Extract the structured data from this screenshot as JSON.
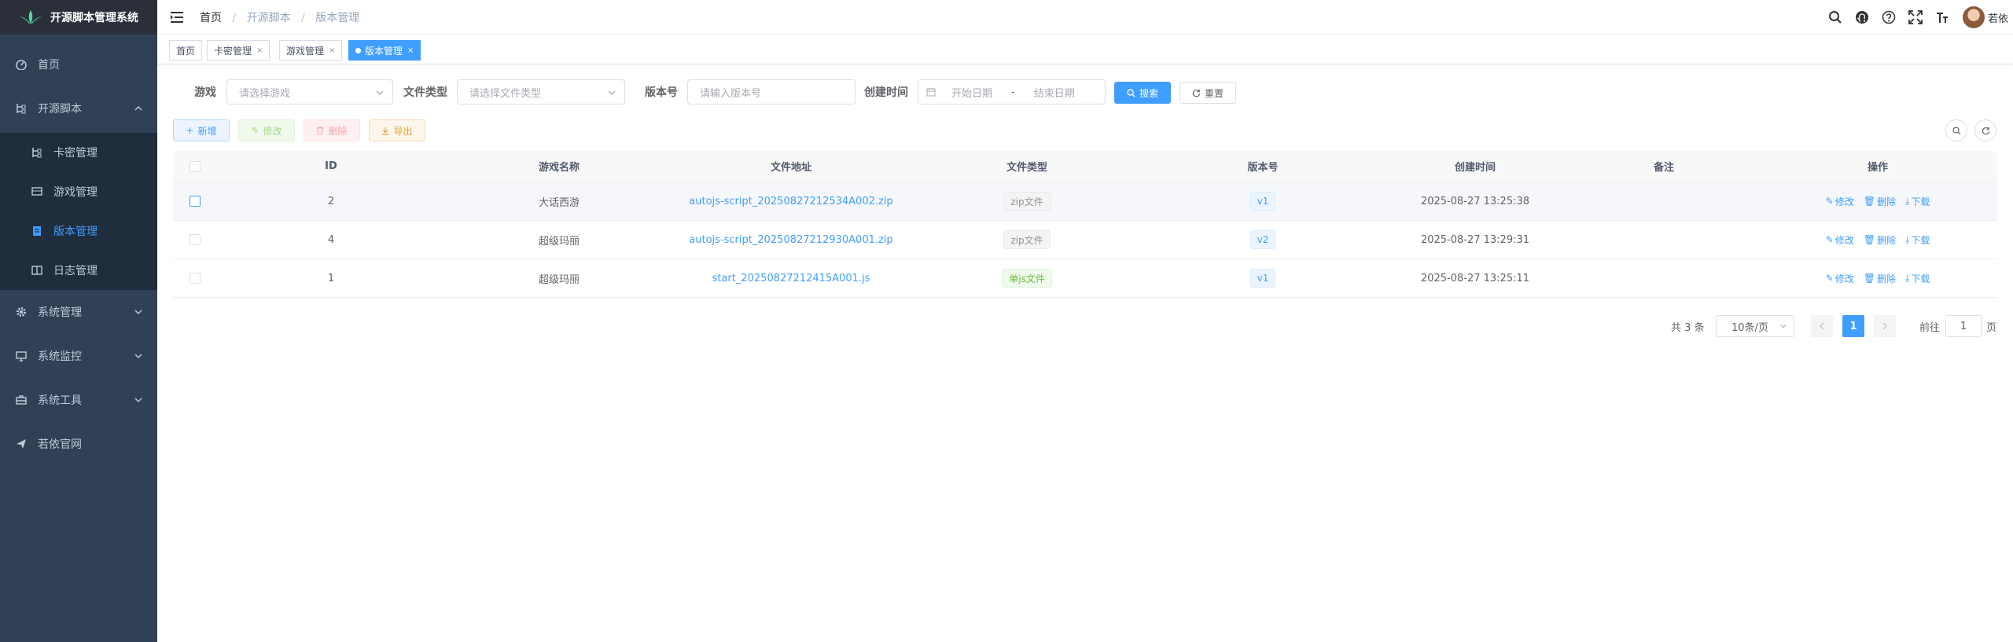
{
  "app": {
    "title": "开源脚本管理系统"
  },
  "sidebar": {
    "items": [
      {
        "label": "首页"
      },
      {
        "label": "开源脚本",
        "children": [
          {
            "label": "卡密管理"
          },
          {
            "label": "游戏管理"
          },
          {
            "label": "版本管理"
          },
          {
            "label": "日志管理"
          }
        ]
      },
      {
        "label": "系统管理"
      },
      {
        "label": "系统监控"
      },
      {
        "label": "系统工具"
      },
      {
        "label": "若依官网"
      }
    ]
  },
  "breadcrumb": [
    "首页",
    "开源脚本",
    "版本管理"
  ],
  "navbar": {
    "username": "若依"
  },
  "tags": [
    {
      "label": "首页"
    },
    {
      "label": "卡密管理",
      "close": "×"
    },
    {
      "label": "游戏管理",
      "close": "×"
    },
    {
      "label": "版本管理",
      "close": "×"
    }
  ],
  "search": {
    "game_label": "游戏",
    "game_placeholder": "请选择游戏",
    "filetype_label": "文件类型",
    "filetype_placeholder": "请选择文件类型",
    "version_label": "版本号",
    "version_placeholder": "请输入版本号",
    "time_label": "创建时间",
    "start_placeholder": "开始日期",
    "range_sep": "-",
    "end_placeholder": "结束日期",
    "search_btn": "搜索",
    "reset_btn": "重置"
  },
  "toolbar": {
    "add": "新增",
    "edit": "修改",
    "delete": "删除",
    "export": "导出"
  },
  "table": {
    "headers": [
      "ID",
      "游戏名称",
      "文件地址",
      "文件类型",
      "版本号",
      "创建时间",
      "备注",
      "操作"
    ],
    "rows": [
      {
        "id": "2",
        "game": "大话西游",
        "file": "autojs-script_20250827212534A002.zip",
        "type": "zip文件",
        "version": "v1",
        "time": "2025-08-27 13:25:38",
        "remark": ""
      },
      {
        "id": "4",
        "game": "超级玛丽",
        "file": "autojs-script_20250827212930A001.zip",
        "type": "zip文件",
        "version": "v2",
        "time": "2025-08-27 13:29:31",
        "remark": ""
      },
      {
        "id": "1",
        "game": "超级玛丽",
        "file": "start_20250827212415A001.js",
        "type": "单js文件",
        "version": "v1",
        "time": "2025-08-27 13:25:11",
        "remark": ""
      }
    ],
    "ops": {
      "edit": "修改",
      "delete": "删除",
      "download": "下载"
    }
  },
  "pagination": {
    "total": "共 3 条",
    "page_size": "10条/页",
    "current": "1",
    "goto_label": "前往",
    "goto_value": "1",
    "page_suffix": "页"
  },
  "colors": {
    "primary": "#409eff",
    "sidebar": "#304156",
    "success": "#67c23a",
    "danger": "#f56c6c",
    "warning": "#e6a23c"
  }
}
